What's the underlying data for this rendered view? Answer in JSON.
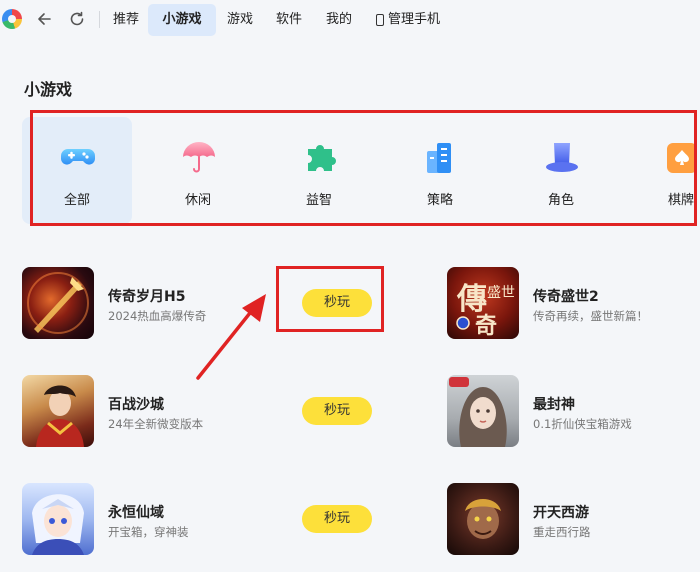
{
  "nav": {
    "tabs": [
      "推荐",
      "小游戏",
      "游戏",
      "软件",
      "我的"
    ],
    "phone_label": "管理手机"
  },
  "section": {
    "title": "小游戏"
  },
  "categories": [
    "全部",
    "休闲",
    "益智",
    "策略",
    "角色",
    "棋牌"
  ],
  "games_left": [
    {
      "name": "传奇岁月H5",
      "desc": "2024热血高爆传奇",
      "button": "秒玩"
    },
    {
      "name": "百战沙城",
      "desc": "24年全新微变版本",
      "button": "秒玩"
    },
    {
      "name": "永恒仙域",
      "desc": "开宝箱，穿神装",
      "button": "秒玩"
    }
  ],
  "games_right": [
    {
      "name": "传奇盛世2",
      "desc": "传奇再续，盛世新篇！"
    },
    {
      "name": "最封神",
      "desc": "0.1折仙侠宝箱游戏"
    },
    {
      "name": "开天西游",
      "desc": "重走西行路"
    }
  ],
  "colors": {
    "accent_tab": "#dce9fb",
    "play_button": "#fde03a",
    "highlight": "#e02323"
  }
}
